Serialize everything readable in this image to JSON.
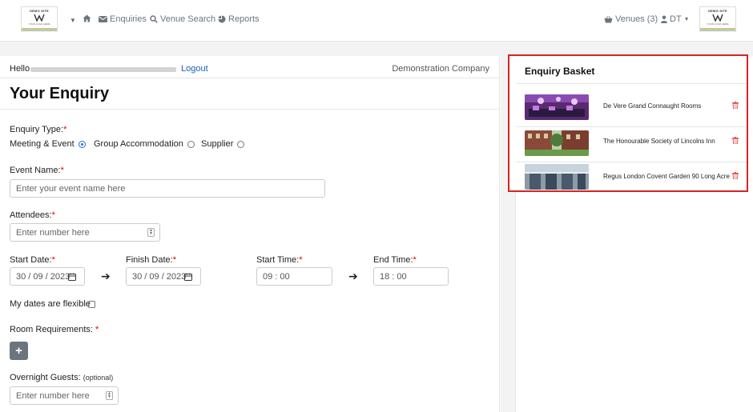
{
  "nav": {
    "logo_left": {
      "top": "DEMO SITE",
      "bottom": "YOUR LOGO HERE"
    },
    "logo_right": {
      "top": "DEMO SITE",
      "bottom": "YOUR LOGO HERE"
    },
    "enquiries": "Enquiries",
    "venue_search": "Venue Search",
    "reports": "Reports",
    "venues": "Venues (3)",
    "user": "DT"
  },
  "header": {
    "hello": "Hello",
    "logout": "Logout",
    "company": "Demonstration Company",
    "title": "Your Enquiry"
  },
  "form": {
    "enquiry_type_label": "Enquiry Type:",
    "enquiry_types": [
      {
        "label": "Meeting & Event",
        "selected": true
      },
      {
        "label": "Group Accommodation",
        "selected": false
      },
      {
        "label": "Supplier",
        "selected": false
      }
    ],
    "event_name_label": "Event Name:",
    "event_name_placeholder": "Enter your event name here",
    "attendees_label": "Attendees:",
    "attendees_placeholder": "Enter number here",
    "start_date_label": "Start Date:",
    "start_date_value": "30 / 09 / 2023",
    "finish_date_label": "Finish Date:",
    "finish_date_value": "30 / 09 / 2023",
    "start_time_label": "Start Time:",
    "start_time_value": "09 : 00",
    "end_time_label": "End Time:",
    "end_time_value": "18 : 00",
    "flexible_label": "My dates are flexible",
    "flexible_checked": false,
    "room_requirements_label": "Room Requirements:",
    "add_room_label": "+",
    "overnight_label": "Overnight Guests:",
    "overnight_optional": "(optional)",
    "overnight_placeholder": "Enter number here",
    "required_mark": "*"
  },
  "basket": {
    "title": "Enquiry Basket",
    "items": [
      {
        "name": "De Vere Grand Connaught Rooms"
      },
      {
        "name": "The Honourable Society of Lincolns Inn"
      },
      {
        "name": "Regus London Covent Garden 90 Long Acre"
      }
    ]
  },
  "colors": {
    "accent": "#1a73e8",
    "link": "#1a5fb4",
    "required": "#dd0000",
    "highlight_border": "#d72323",
    "trash": "#e05555"
  }
}
